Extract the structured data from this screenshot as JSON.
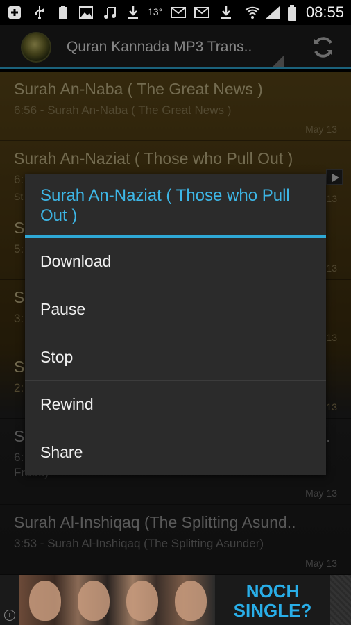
{
  "status_bar": {
    "icons": [
      "add-box-icon",
      "usb-icon",
      "battery-full-icon",
      "image-icon",
      "music-note-icon",
      "download-icon",
      "email-icon",
      "email-icon",
      "download-icon",
      "wifi-icon",
      "signal-icon",
      "battery-icon"
    ],
    "temperature": "13°",
    "time": "08:55"
  },
  "action_bar": {
    "title": "Quran Kannada MP3 Trans..",
    "accent_color": "#2fa9d6"
  },
  "list": {
    "items": [
      {
        "title": "Surah An-Naba ( The Great News )",
        "subtitle": "6:56 - Surah An-Naba ( The Great News )",
        "date": "May 13"
      },
      {
        "title": "Surah An-Naziat ( Those who Pull Out )",
        "subtitle": "6:",
        "subtitle2": "St",
        "date": "13"
      },
      {
        "title": "S",
        "subtitle": "5:",
        "date": "13"
      },
      {
        "title": "S",
        "subtitle": "3:",
        "date": "13"
      },
      {
        "title": "S",
        "subtitle": "2:",
        "date": "13"
      },
      {
        "title": "S",
        "subtitle": "6:",
        "subtitle2": "Fraud)",
        "title_tail": ".",
        "date": "May 13"
      },
      {
        "title": "Surah Al-Inshiqaq (The Splitting Asund..",
        "subtitle": "3:53 - Surah Al-Inshiqaq (The Splitting Asunder)",
        "date": "May 13"
      }
    ]
  },
  "dialog": {
    "title": "Surah An-Naziat ( Those who Pull Out )",
    "items": [
      "Download",
      "Pause",
      "Stop",
      "Rewind",
      "Share"
    ]
  },
  "ad": {
    "line1": "NOCH",
    "line2": "SINGLE?",
    "info": "i"
  }
}
